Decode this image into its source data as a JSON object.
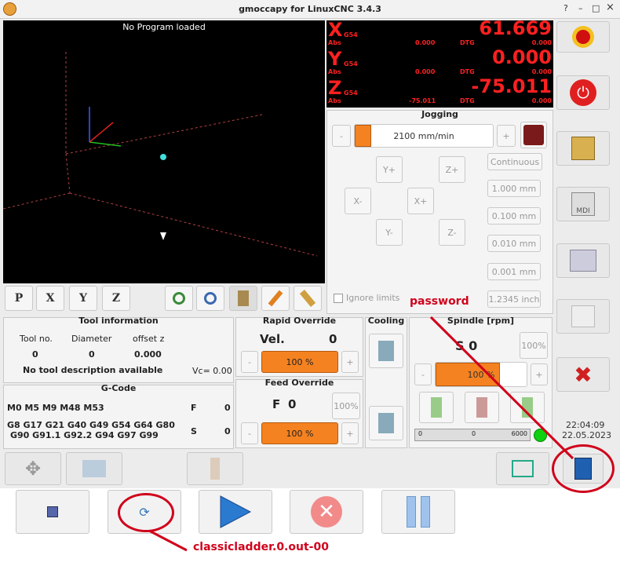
{
  "window": {
    "title": "gmoccapy for LinuxCNC  3.4.3",
    "btn_help": "?",
    "btn_min": "–",
    "btn_max": "□",
    "btn_close": "×"
  },
  "preview": {
    "message": "No Program loaded"
  },
  "dro": {
    "x": {
      "axis": "X",
      "coord": "G54",
      "value": "61.669",
      "abs_label": "Abs",
      "abs_value": "0.000",
      "dtg_label": "DTG",
      "dtg_value": "0.000"
    },
    "y": {
      "axis": "Y",
      "coord": "G54",
      "value": "0.000",
      "abs_label": "Abs",
      "abs_value": "0.000",
      "dtg_label": "DTG",
      "dtg_value": "0.000"
    },
    "z": {
      "axis": "Z",
      "coord": "G54",
      "value": "-75.011",
      "abs_label": "Abs",
      "abs_value": "-75.011",
      "dtg_label": "DTG",
      "dtg_value": "0.000"
    }
  },
  "jogging": {
    "title": "Jogging",
    "minus": "-",
    "plus": "+",
    "speed": "2100 mm/min",
    "speed_fraction": 0.12,
    "yplus": "Y+",
    "zplus": "Z+",
    "xminus": "X-",
    "xplus": "X+",
    "yminus": "Y-",
    "zminus": "Z-",
    "increments": [
      "Continuous",
      "1.000 mm",
      "0.100 mm",
      "0.010 mm",
      "0.001 mm",
      "1.2345 inch"
    ],
    "ignore_limits": "Ignore limits"
  },
  "view_buttons": {
    "p": "P",
    "x": "X",
    "y": "Y",
    "z": "Z"
  },
  "tool": {
    "title": "Tool information",
    "headers": [
      "Tool no.",
      "Diameter",
      "offset z"
    ],
    "values": [
      "0",
      "0",
      "0.000"
    ],
    "description": "No tool description available",
    "vc": "Vc= 0.00"
  },
  "rapid": {
    "title": "Rapid Override",
    "label": "Vel.",
    "value": "0",
    "percent": "100 %",
    "minus": "-",
    "plus": "+"
  },
  "feed": {
    "title": "Feed Override",
    "label": "F",
    "value": "0",
    "percent": "100 %",
    "percent_btn": "100%",
    "minus": "-",
    "plus": "+"
  },
  "cooling": {
    "title": "Cooling"
  },
  "spindle": {
    "title": "Spindle [rpm]",
    "speed": "S 0",
    "percent_btn": "100%",
    "percent": "100 %",
    "minus": "-",
    "plus": "+",
    "bar_min": "0",
    "bar_mid": "0",
    "bar_max": "6000"
  },
  "gcode": {
    "title": "G-Code",
    "mcodes": "M0 M5 M9 M48 M53",
    "f_label": "F",
    "f_value": "0",
    "gcodes_line1": "G8 G17 G21 G40 G49 G54 G64 G80",
    "gcodes_line2": "G90 G91.1 G92.2 G94 G97 G99",
    "s_label": "S",
    "s_value": "0"
  },
  "clock": {
    "time": "22:04:09",
    "date": "22.05.2023"
  },
  "annotations": {
    "password": "password",
    "classicladder": "classicladder.0.out-00"
  },
  "colors": {
    "accent_orange": "#f58220",
    "dro_red": "#ff2020",
    "annotation_red": "#d0021b"
  }
}
